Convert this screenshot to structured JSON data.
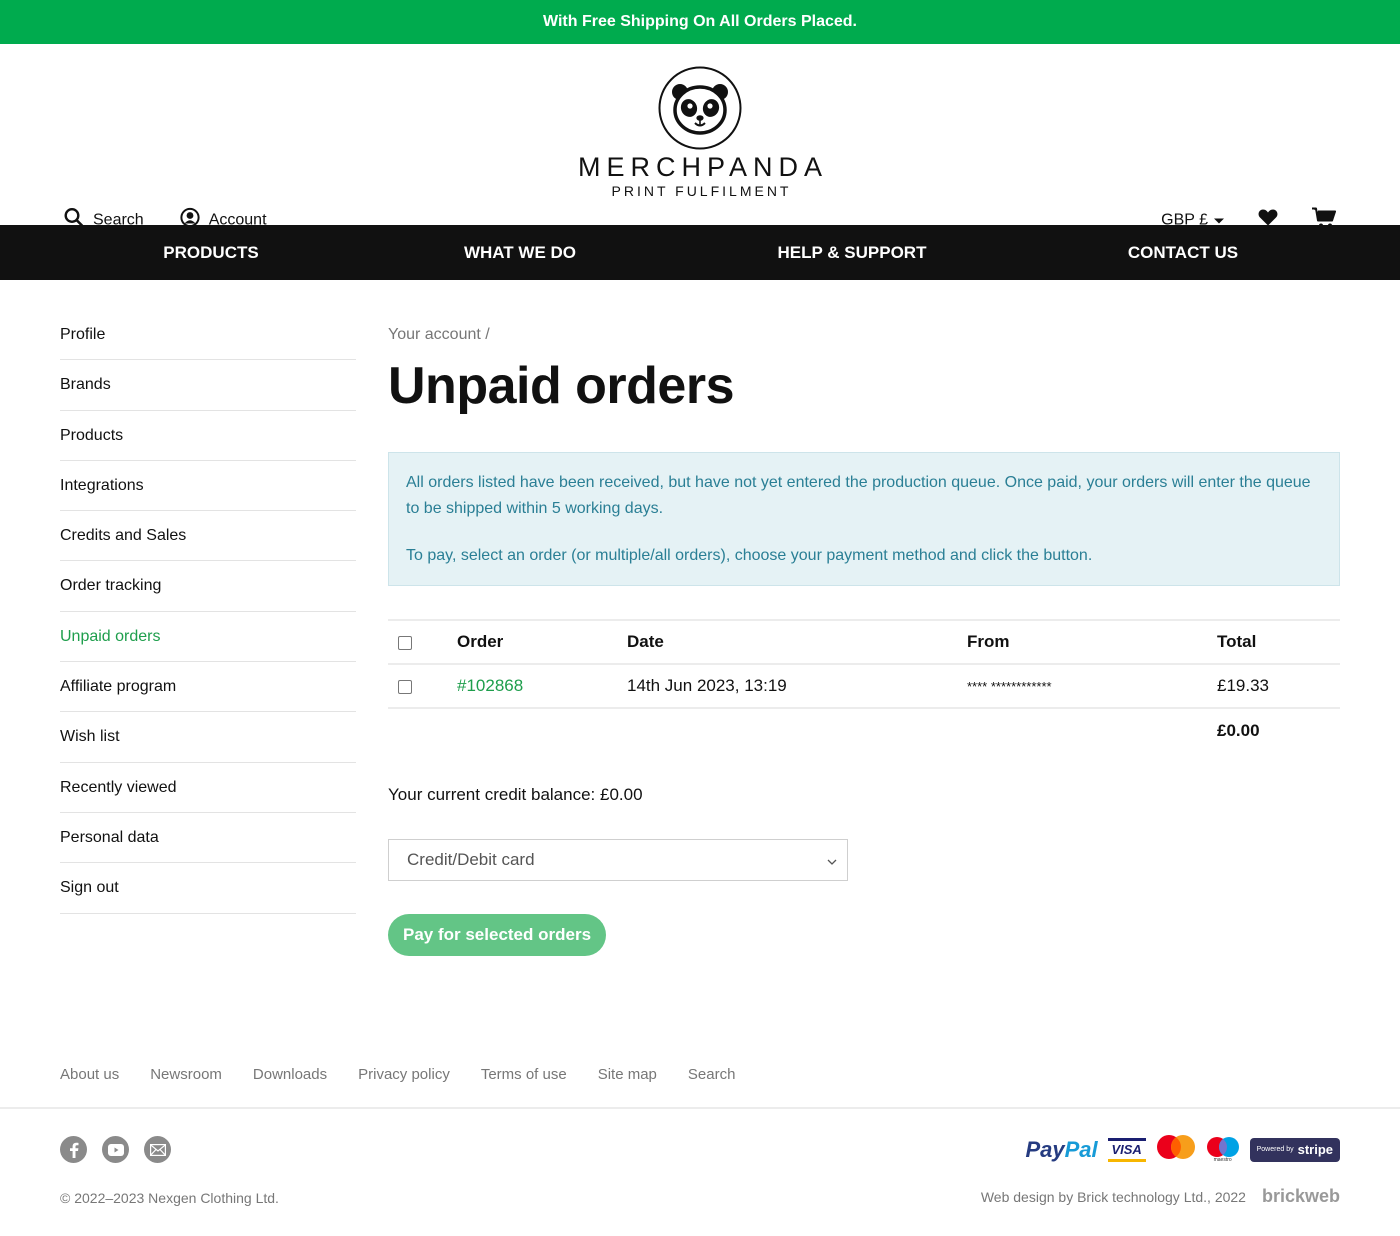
{
  "promo": {
    "text": "With Free Shipping On All Orders Placed."
  },
  "header": {
    "search_label": "Search",
    "account_label": "Account",
    "logo_brand": "MERCHPANDA",
    "logo_tagline": "PRINT FULFILMENT",
    "currency_label": "GBP £",
    "icons": [
      "search-icon",
      "account-icon",
      "panda-logo",
      "caret-down-icon",
      "heart-icon",
      "cart-icon"
    ]
  },
  "nav": {
    "items": [
      {
        "label": "PRODUCTS"
      },
      {
        "label": "WHAT WE DO"
      },
      {
        "label": "HELP & SUPPORT"
      },
      {
        "label": "CONTACT US"
      }
    ]
  },
  "sidebar": {
    "active": "Unpaid orders",
    "items": [
      {
        "label": "Profile"
      },
      {
        "label": "Brands"
      },
      {
        "label": "Products"
      },
      {
        "label": "Integrations"
      },
      {
        "label": "Credits and Sales"
      },
      {
        "label": "Order tracking"
      },
      {
        "label": "Unpaid orders"
      },
      {
        "label": "Affiliate program"
      },
      {
        "label": "Wish list"
      },
      {
        "label": "Recently viewed"
      },
      {
        "label": "Personal data"
      },
      {
        "label": "Sign out"
      }
    ]
  },
  "main": {
    "breadcrumb": "Your account  /",
    "title": "Unpaid orders",
    "info": {
      "paragraph1": "All orders listed have been received, but have not yet entered the production queue. Once paid, your orders will enter the queue to be shipped within 5 working days.",
      "paragraph2": "To pay, select an order (or multiple/all orders), choose your payment method and click the button."
    },
    "table": {
      "headers": {
        "order": "Order",
        "date": "Date",
        "from": "From",
        "total": "Total"
      },
      "rows": [
        {
          "order": "#102868",
          "date": "14th Jun 2023, 13:19",
          "from": "**** ************",
          "total": "£19.33",
          "checked": false
        }
      ],
      "selected_total": "£0.00"
    },
    "credit_balance": "Your current credit balance: £0.00",
    "payment_method": {
      "selected": "Credit/Debit card"
    },
    "pay_button": "Pay for selected orders"
  },
  "footer": {
    "links": [
      "About us",
      "Newsroom",
      "Downloads",
      "Privacy policy",
      "Terms of use",
      "Site map",
      "Search"
    ],
    "social": [
      "facebook-icon",
      "youtube-icon",
      "email-icon"
    ],
    "copyright": "© 2022–2023 Nexgen Clothing Ltd.",
    "payment_logos": {
      "paypal": "PayPal",
      "visa": "VISA",
      "maestro": "maestro",
      "stripe_prefix": "Powered by",
      "stripe": "stripe"
    },
    "credit_text": "Web design by Brick technology Ltd., 2022",
    "credit_brand": "brickweb"
  },
  "colors": {
    "promo": "#00ab4e",
    "accent": "#1e9e4c",
    "nav": "#111111",
    "info_bg": "#e5f2f5",
    "info_text": "#2a7f95",
    "pay_button": "#63c586"
  }
}
